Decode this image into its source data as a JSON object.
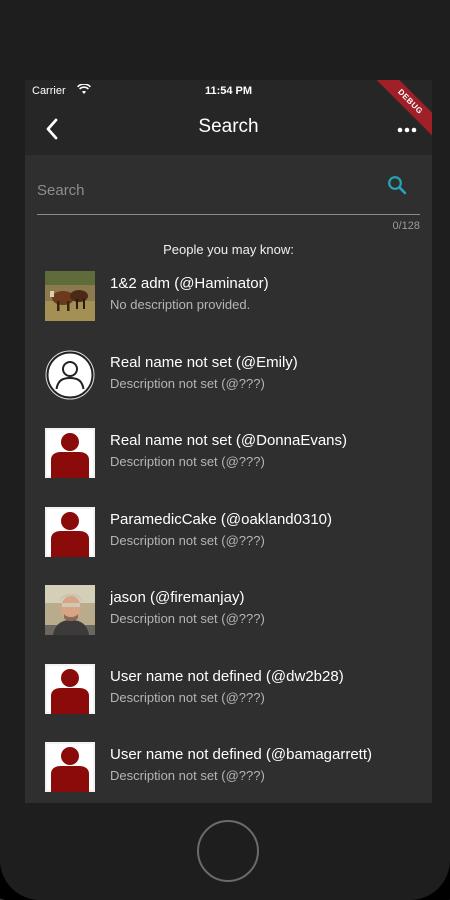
{
  "status_bar": {
    "carrier": "Carrier",
    "time": "11:54 PM"
  },
  "app_bar": {
    "title": "Search",
    "back_icon": "chevron-left-icon",
    "more_icon": "more-horizontal-icon"
  },
  "debug_banner": "DEBUG",
  "search": {
    "placeholder": "Search",
    "value": "",
    "counter": "0/128",
    "icon": "search-icon"
  },
  "section_heading": "People you may know:",
  "colors": {
    "accent": "#26a5b8",
    "avatar_red": "#8b0a0a",
    "background": "#2f2f30"
  },
  "people": [
    {
      "name": "1&2 adm (@Haminator)",
      "description": "No description provided.",
      "avatar": "photo-animals"
    },
    {
      "name": "Real name not set (@Emily)",
      "description": "Description not set (@???)",
      "avatar": "default-user-outline"
    },
    {
      "name": "Real name not set (@DonnaEvans)",
      "description": "Description not set (@???)",
      "avatar": "default-user-red"
    },
    {
      "name": "ParamedicCake (@oakland0310)",
      "description": "Description not set (@???)",
      "avatar": "default-user-red"
    },
    {
      "name": "jason (@firemanjay)",
      "description": "Description not set (@???)",
      "avatar": "photo-person"
    },
    {
      "name": "User name not defined (@dw2b28)",
      "description": "Description not set (@???)",
      "avatar": "default-user-red"
    },
    {
      "name": "User name not defined (@bamagarrett)",
      "description": "Description not set (@???)",
      "avatar": "default-user-red"
    }
  ]
}
